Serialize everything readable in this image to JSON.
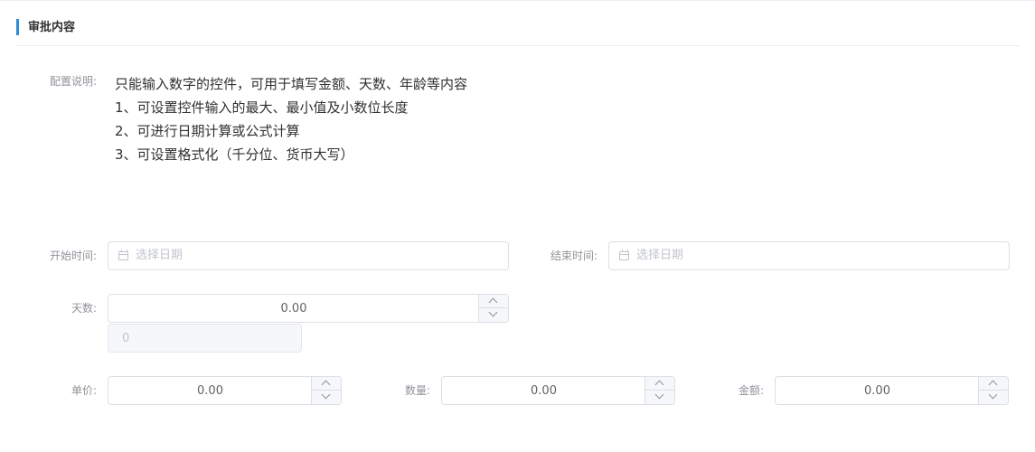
{
  "section": {
    "title": "审批内容"
  },
  "config": {
    "label": "配置说明:",
    "lines": [
      "只能输入数字的控件，可用于填写金额、天数、年龄等内容",
      "1、可设置控件输入的最大、最小值及小数位长度",
      "2、可进行日期计算或公式计算",
      "3、可设置格式化（千分位、货币大写）"
    ]
  },
  "start_time": {
    "label": "开始时间:",
    "placeholder": "选择日期",
    "icon": "calendar-icon"
  },
  "end_time": {
    "label": "结束时间:",
    "placeholder": "选择日期",
    "icon": "calendar-icon"
  },
  "days": {
    "label": "天数:",
    "value": "0.00",
    "computed": "0"
  },
  "unit_price": {
    "label": "单价:",
    "value": "0.00"
  },
  "quantity": {
    "label": "数量:",
    "value": "0.00"
  },
  "amount": {
    "label": "金额:",
    "value": "0.00"
  },
  "colors": {
    "accent": "#2f8cd6",
    "border": "#dcdfe6",
    "label": "#909399",
    "placeholder": "#c0c4cc"
  }
}
